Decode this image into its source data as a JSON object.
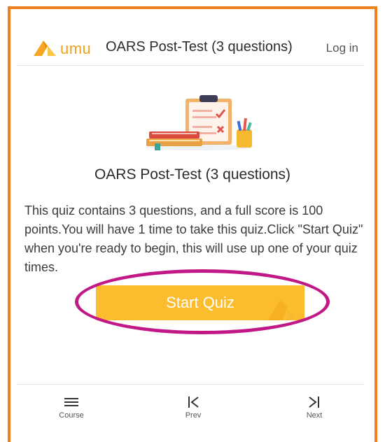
{
  "header": {
    "logo_text": "umu",
    "title": "OARS Post-Test (3 questions)",
    "login_label": "Log in"
  },
  "quiz": {
    "title": "OARS Post-Test (3 questions)",
    "description": "This quiz contains 3 questions, and a full score is 100 points.You will have 1 time to take this quiz.Click \"Start Quiz\" when you're ready to begin, this will use up one of your quiz times.",
    "start_label": "Start Quiz"
  },
  "nav": {
    "course_label": "Course",
    "prev_label": "Prev",
    "next_label": "Next"
  },
  "colors": {
    "accent": "#fbbd2d",
    "frame": "#f07f1f",
    "highlight": "#c21786",
    "logo": "#f0a11d"
  },
  "icons": [
    "umu-logo-icon",
    "quiz-clipboard-illustration",
    "menu-icon",
    "first-page-icon",
    "last-page-icon"
  ]
}
